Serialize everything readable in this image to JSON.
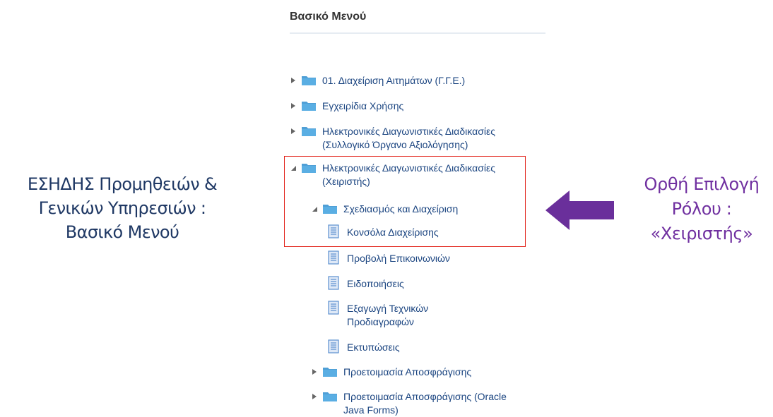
{
  "left_caption": [
    "ΕΣΗΔΗΣ Προμηθειών &",
    "Γενικών Υπηρεσιών :",
    "Βασικό Μενού"
  ],
  "right_caption": [
    "Ορθή Επιλογή",
    "Ρόλου :",
    "«Χειριστής»"
  ],
  "menu": {
    "title": "Βασικό Μενού",
    "items": [
      {
        "label": "01. Διαχείριση Αιτημάτων (Γ.Γ.Ε.)",
        "type": "folder",
        "state": "collapsed"
      },
      {
        "label": "Εγχειρίδια Χρήσης",
        "type": "folder",
        "state": "collapsed"
      },
      {
        "label": [
          "Ηλεκτρονικές Διαγωνιστικές Διαδικασίες",
          "(Συλλογικό Όργανο Αξιολόγησης)"
        ],
        "type": "folder",
        "state": "collapsed"
      },
      {
        "label": [
          "Ηλεκτρονικές Διαγωνιστικές Διαδικασίες",
          "(Χειριστής)"
        ],
        "type": "folder",
        "state": "expanded"
      },
      {
        "label": "Σχεδιασμός και Διαχείριση",
        "type": "folder",
        "state": "expanded"
      },
      {
        "label": "Κονσόλα Διαχείρισης",
        "type": "page"
      },
      {
        "label": "Προβολή Επικοινωνιών",
        "type": "page"
      },
      {
        "label": "Ειδοποιήσεις",
        "type": "page"
      },
      {
        "label": [
          "Εξαγωγή Τεχνικών",
          "Προδιαγραφών"
        ],
        "type": "page"
      },
      {
        "label": "Εκτυπώσεις",
        "type": "page"
      },
      {
        "label": "Προετοιμασία Αποσφράγισης",
        "type": "folder",
        "state": "collapsed"
      },
      {
        "label": [
          "Προετοιμασία Αποσφράγισης (Oracle",
          "Java Forms)"
        ],
        "type": "folder",
        "state": "collapsed"
      }
    ]
  },
  "colors": {
    "left_caption": "#1f3864",
    "right_caption": "#7030a0",
    "arrow": "#6a2f9b",
    "highlight_box": "#e2231a",
    "link": "#1a4480",
    "folder": "#4f9fd6",
    "page_icon": "#5b8fcf"
  }
}
